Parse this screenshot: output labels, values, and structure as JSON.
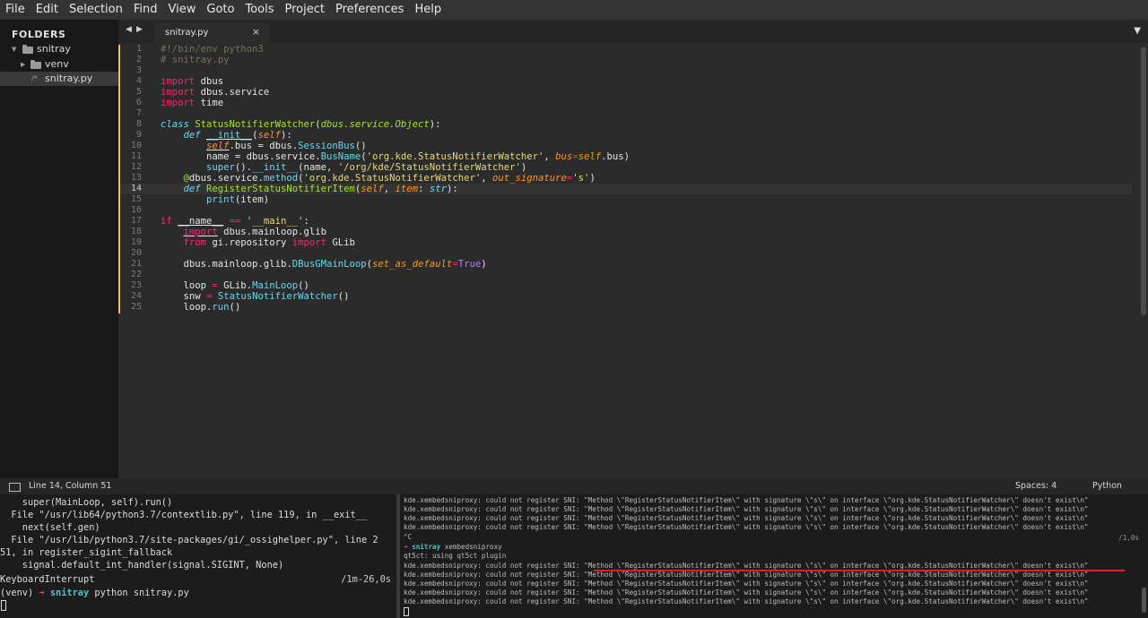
{
  "menu": [
    "File",
    "Edit",
    "Selection",
    "Find",
    "View",
    "Goto",
    "Tools",
    "Project",
    "Preferences",
    "Help"
  ],
  "sidebar": {
    "header": "FOLDERS",
    "root": "snitray",
    "items": [
      "venv",
      "snitray.py"
    ],
    "file_prefix": "/*"
  },
  "tabbar": {
    "nav_left": "◀",
    "nav_right": "▶",
    "tab_label": "snitray.py",
    "tab_close": "×",
    "menu_arrow": "▼"
  },
  "editor": {
    "current_line": 14,
    "line_numbers": [
      "1",
      "2",
      "3",
      "4",
      "5",
      "6",
      "7",
      "8",
      "9",
      "10",
      "11",
      "12",
      "13",
      "14",
      "15",
      "16",
      "17",
      "18",
      "19",
      "20",
      "21",
      "22",
      "23",
      "24",
      "25"
    ],
    "code": {
      "l1": "#!/bin/env python3",
      "l2": "# snitray.py",
      "l4_kw": "import",
      "l4_rest": " dbus",
      "l5_kw": "import",
      "l5_rest": " dbus.service",
      "l6_kw": "import",
      "l6_rest": " time",
      "l8_kw": "class",
      "l8_name": "StatusNotifierWatcher",
      "l8_base": "dbus.service.Object",
      "l8_end": "):",
      "l9_def": "def",
      "l9_name": "__init__",
      "l9_self": "self",
      "l9_end": "):",
      "l10_self": "self",
      "l10_mid": ".bus = dbus.",
      "l10_fn": "SessionBus",
      "l10_end": "()",
      "l11_a": "name = dbus.service.",
      "l11_fn": "BusName",
      "l11_str": "'org.kde.StatusNotifierWatcher'",
      "l11_param": "bus",
      "l11_self": "self",
      "l11_end": ".bus)",
      "l12_fn": "super",
      "l12_a": "().",
      "l12_init": "__init__",
      "l12_b": "(name, ",
      "l12_str": "'/org/kde/StatusNotifierWatcher'",
      "l12_end": ")",
      "l13_at": "@",
      "l13_a": "dbus.service.",
      "l13_fn": "method",
      "l13_str": "'org.kde.StatusNotifierWatcher'",
      "l13_param": "out_signature",
      "l13_str2": "'s'",
      "l13_end": ")",
      "l14_def": "def",
      "l14_name": "RegisterStatusNotifierItem",
      "l14_self": "self",
      "l14_param": "item",
      "l14_type": "str",
      "l14_end": "):",
      "l15_fn": "print",
      "l15_end": "(item)",
      "l17_kw": "if",
      "l17_a": "__name__",
      "l17_op": "==",
      "l17_str": "'__main__'",
      "l17_end": ":",
      "l18_kw": "import",
      "l18_rest": " dbus.mainloop.glib",
      "l19_kw": "from",
      "l19_a": " gi.repository ",
      "l19_kw2": "import",
      "l19_rest": " GLib",
      "l21_a": "dbus.mainloop.glib.",
      "l21_fn": "DBusGMainLoop",
      "l21_param": "set_as_default",
      "l21_const": "True",
      "l21_end": ")",
      "l23_a": "loop ",
      "l23_op": "=",
      "l23_b": " GLib.",
      "l23_fn": "MainLoop",
      "l23_end": "()",
      "l24_a": "snw ",
      "l24_op": "=",
      "l24_fn": "StatusNotifierWatcher",
      "l24_end": "()",
      "l25_a": "loop.",
      "l25_fn": "run",
      "l25_end": "()"
    }
  },
  "statusbar": {
    "position": "Line 14, Column 51",
    "spaces": "Spaces: 4",
    "syntax": "Python"
  },
  "terminal_left": {
    "lines": [
      "    super(MainLoop, self).run()",
      "  File \"/usr/lib64/python3.7/contextlib.py\", line 119, in __exit__",
      "    next(self.gen)",
      "  File \"/usr/lib/python3.7/site-packages/gi/_ossighelper.py\", line 2",
      "51, in register_sigint_fallback",
      "    signal.default_int_handler(signal.SIGINT, None)",
      "KeyboardInterrupt"
    ],
    "timer": "/1m-26,0s",
    "prompt_env": "(venv) ",
    "prompt_arrow": "➜",
    "prompt_dir": "snitray",
    "prompt_cmd": " python snitray.py"
  },
  "terminal_right": {
    "err_line": "kde.xembedsniproxy: could not register SNI: \"Method \\\"RegisterStatusNotifierItem\\\" with signature \\\"s\\\" on interface \\\"org.kde.StatusNotifierWatcher\\\" doesn't exist\\n\"",
    "interrupt": "^C",
    "timer": "/1,0s",
    "prompt_arrow": "➜",
    "prompt_dir": "snitray",
    "prompt_cmd": " xembedsniproxy",
    "qt_line": "qt5ct: using qt5ct plugin"
  }
}
